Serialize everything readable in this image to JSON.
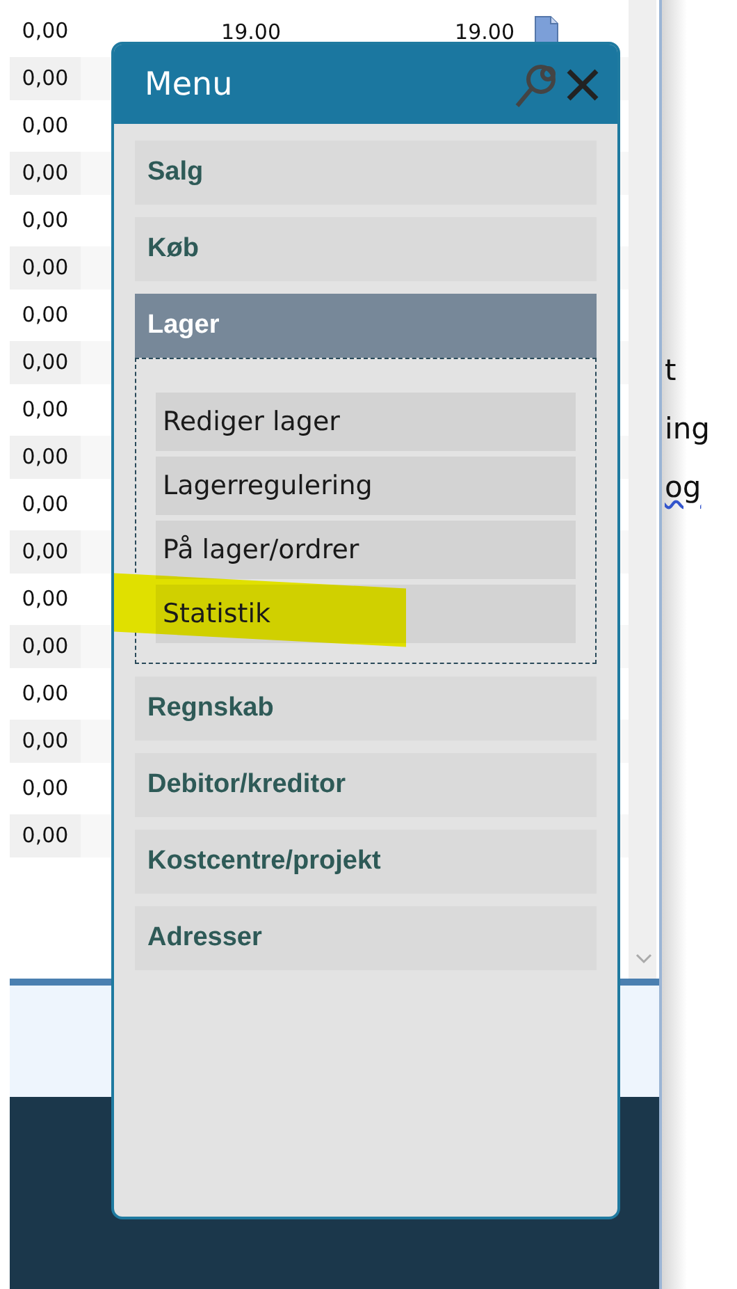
{
  "table": {
    "rows": [
      {
        "cells": [
          "0,00",
          "19.00",
          "19.00"
        ],
        "has_document": true
      },
      {
        "cells": [
          "0,00"
        ],
        "has_document": false
      },
      {
        "cells": [
          "0,00"
        ],
        "has_document": false
      },
      {
        "cells": [
          "0,00"
        ],
        "has_document": false
      },
      {
        "cells": [
          "0,00"
        ],
        "has_document": false
      },
      {
        "cells": [
          "0,00"
        ],
        "has_document": false
      },
      {
        "cells": [
          "0,00"
        ],
        "has_document": false
      },
      {
        "cells": [
          "0,00"
        ],
        "has_document": false
      },
      {
        "cells": [
          "0,00"
        ],
        "has_document": false
      },
      {
        "cells": [
          "0,00"
        ],
        "has_document": false
      },
      {
        "cells": [
          "0,00"
        ],
        "has_document": false
      },
      {
        "cells": [
          "0,00"
        ],
        "has_document": false
      },
      {
        "cells": [
          "0,00"
        ],
        "has_document": false
      },
      {
        "cells": [
          "0,00"
        ],
        "has_document": false
      },
      {
        "cells": [
          "0,00"
        ],
        "has_document": false
      },
      {
        "cells": [
          "0,00"
        ],
        "has_document": false
      },
      {
        "cells": [
          "0,00"
        ],
        "has_document": false
      },
      {
        "cells": [
          "0,00"
        ],
        "has_document": false
      }
    ]
  },
  "side_pane": {
    "lines": [
      {
        "text": "t",
        "flagged": false
      },
      {
        "text": "ing",
        "flagged": false
      },
      {
        "text": "og",
        "flagged": true
      }
    ]
  },
  "menu": {
    "title": "Menu",
    "sections": [
      {
        "label": "Salg",
        "expanded": false
      },
      {
        "label": "Køb",
        "expanded": false
      },
      {
        "label": "Lager",
        "expanded": true,
        "children": [
          {
            "label": "Rediger lager",
            "highlighted": false
          },
          {
            "label": "Lagerregulering",
            "highlighted": false
          },
          {
            "label": "På lager/ordrer",
            "highlighted": false
          },
          {
            "label": "Statistik",
            "highlighted": true
          }
        ]
      },
      {
        "label": "Regnskab",
        "expanded": false
      },
      {
        "label": "Debitor/kreditor",
        "expanded": false
      },
      {
        "label": "Kostcentre/projekt",
        "expanded": false
      },
      {
        "label": "Adresser",
        "expanded": false
      }
    ]
  }
}
